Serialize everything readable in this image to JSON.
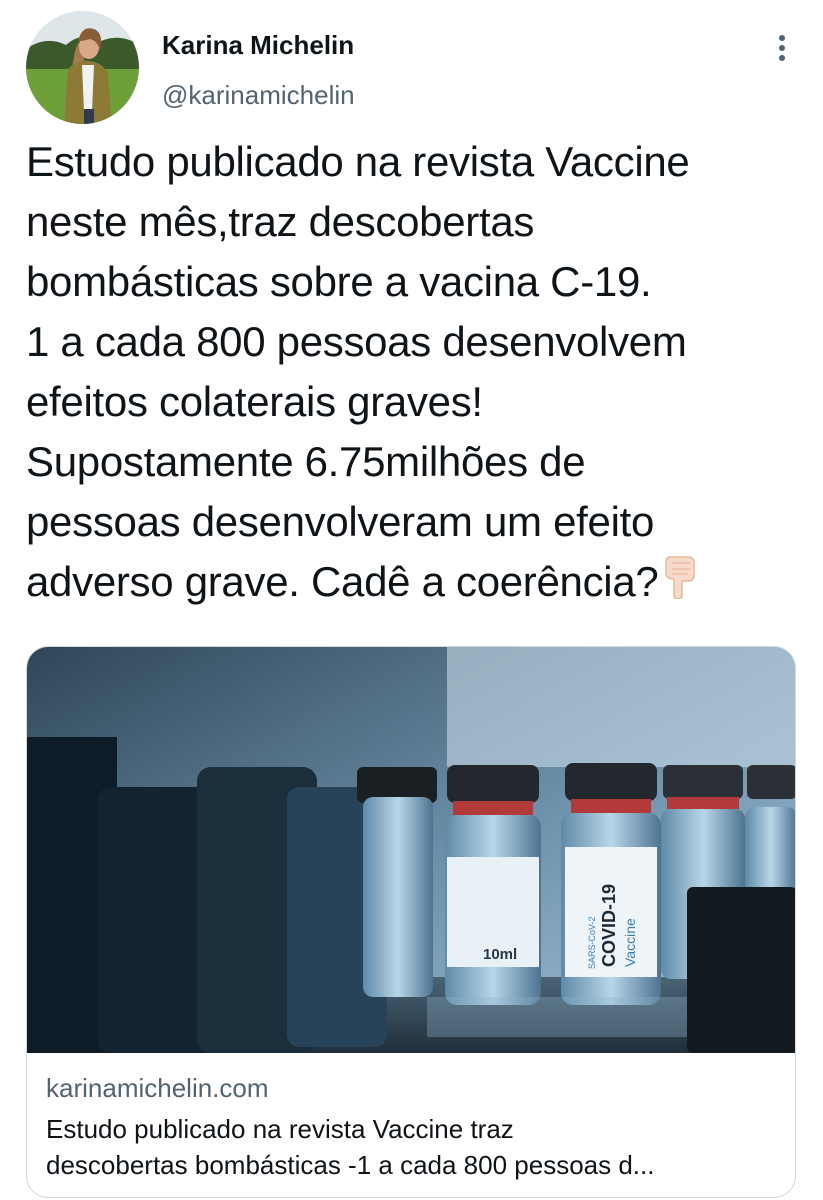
{
  "author": {
    "name": "Karina Michelin",
    "handle": "@karinamichelin"
  },
  "tweet": {
    "lines": [
      "Estudo publicado na revista Vaccine",
      "neste mês,traz descobertas",
      "bombásticas sobre a vacina C-19.",
      "1 a cada 800 pessoas desenvolvem",
      "efeitos colaterais graves!",
      "Supostamente 6.75milhões de",
      "pessoas desenvolveram um efeito",
      "adverso grave. Cadê a coerência?"
    ],
    "trailing_emoji": "pointing-down-hand-icon"
  },
  "link_card": {
    "domain": "karinamichelin.com",
    "description_lines": [
      "Estudo publicado na revista Vaccine traz",
      "descobertas bombásticas -1 a cada 800 pessoas d..."
    ],
    "image_labels": {
      "vial_size": "10ml",
      "brand": "COVID-19",
      "product": "Vaccine",
      "virus": "SARS-CoV-2"
    }
  },
  "colors": {
    "text_primary": "#0f1419",
    "text_secondary": "#536471",
    "card_border": "#cfd9de"
  }
}
